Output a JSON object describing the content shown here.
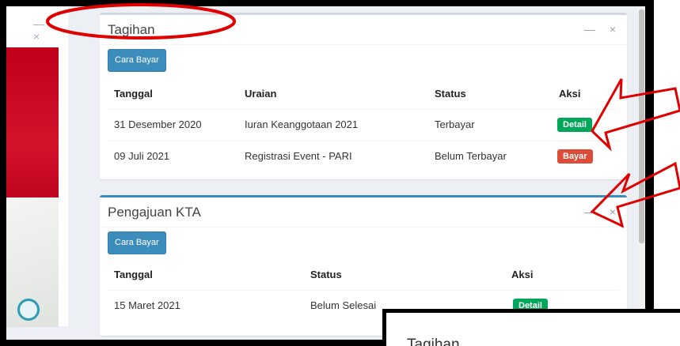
{
  "left_panel": {
    "minimize_icon": "—",
    "close_icon": "×"
  },
  "tagihan": {
    "title": "Tagihan",
    "tools": {
      "minimize": "—",
      "close": "×"
    },
    "button": "Cara Bayar",
    "headers": [
      "Tanggal",
      "Uraian",
      "Status",
      "Aksi"
    ],
    "rows": [
      {
        "tanggal": "31 Desember 2020",
        "uraian": "Iuran Keanggotaan 2021",
        "status": "Terbayar",
        "aksi": "Detail",
        "aksi_color": "#00a65a"
      },
      {
        "tanggal": "09 Juli 2021",
        "uraian": "Registrasi Event - PARI",
        "status": "Belum Terbayar",
        "aksi": "Bayar",
        "aksi_color": "#dd4b39"
      }
    ]
  },
  "pengajuan": {
    "title": "Pengajuan KTA",
    "tools": {
      "minimize": "—",
      "close": "×"
    },
    "button": "Cara Bayar",
    "headers": [
      "Tanggal",
      "Status",
      "Aksi"
    ],
    "rows": [
      {
        "tanggal": "15 Maret 2021",
        "status": "Belum Selesai",
        "aksi": "Detail",
        "aksi_color": "#00a65a"
      }
    ]
  },
  "popup": {
    "title": "Tagihan"
  },
  "colors": {
    "primary": "#3c8dbc",
    "success": "#00a65a",
    "danger": "#dd4b39",
    "annotation": "#e00000"
  }
}
